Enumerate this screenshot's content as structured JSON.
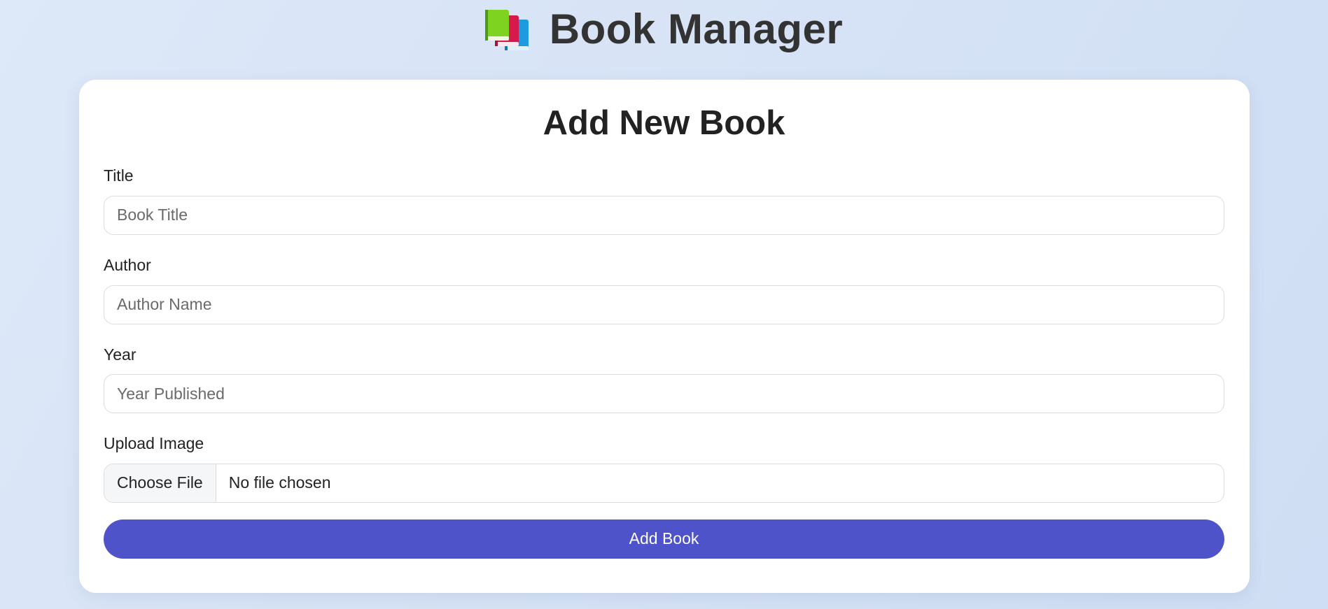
{
  "header": {
    "icon": "books-icon",
    "title": "Book Manager"
  },
  "form": {
    "heading": "Add New Book",
    "fields": {
      "title": {
        "label": "Title",
        "placeholder": "Book Title",
        "value": ""
      },
      "author": {
        "label": "Author",
        "placeholder": "Author Name",
        "value": ""
      },
      "year": {
        "label": "Year",
        "placeholder": "Year Published",
        "value": ""
      },
      "image": {
        "label": "Upload Image",
        "button_label": "Choose File",
        "status": "No file chosen"
      }
    },
    "submit_label": "Add Book"
  },
  "colors": {
    "accent": "#4f53c9",
    "background": "#d6e3f6",
    "card": "#ffffff",
    "title_text": "#333333"
  }
}
